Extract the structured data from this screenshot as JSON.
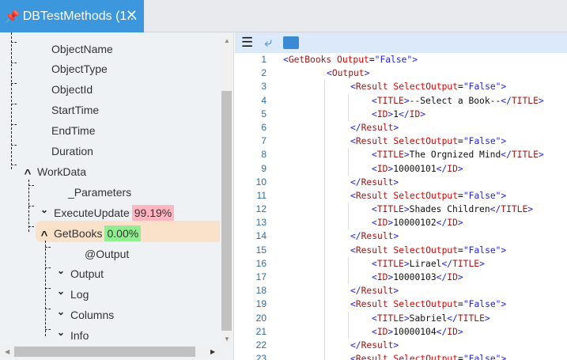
{
  "tab": {
    "title": "DBTestMethods (1...",
    "pin_icon": "pin-icon",
    "close_icon": "close-icon"
  },
  "tree": [
    {
      "label": "ObjectName",
      "depth": 1,
      "chev": ""
    },
    {
      "label": "ObjectType",
      "depth": 1,
      "chev": ""
    },
    {
      "label": "ObjectId",
      "depth": 1,
      "chev": ""
    },
    {
      "label": "StartTime",
      "depth": 1,
      "chev": ""
    },
    {
      "label": "EndTime",
      "depth": 1,
      "chev": ""
    },
    {
      "label": "Duration",
      "depth": 1,
      "chev": ""
    },
    {
      "label": "WorkData",
      "depth": 1,
      "chev": "up"
    },
    {
      "label": "_Parameters",
      "depth": 2,
      "chev": ""
    },
    {
      "label": "ExecuteUpdate",
      "depth": 2,
      "chev": "down",
      "badge": "99.19%",
      "badge_color": "#ffb6c1"
    },
    {
      "label": "GetBooks",
      "depth": 2,
      "chev": "up",
      "badge": "0.00%",
      "badge_color": "#90ee90",
      "selected": true
    },
    {
      "label": "@Output",
      "depth": 3,
      "chev": ""
    },
    {
      "label": "Output",
      "depth": 3,
      "chev": "down"
    },
    {
      "label": "Log",
      "depth": 3,
      "chev": "down"
    },
    {
      "label": "Columns",
      "depth": 3,
      "chev": "down"
    },
    {
      "label": "Info",
      "depth": 3,
      "chev": "down"
    }
  ],
  "toolbar": {
    "icons": [
      "align-left-icon",
      "word-wrap-icon",
      "panel-icon"
    ]
  },
  "code": [
    {
      "n": "1",
      "i": 0,
      "s": [
        [
          "b",
          "<"
        ],
        [
          "t",
          "GetBooks "
        ],
        [
          "a",
          "Output"
        ],
        [
          "x",
          "="
        ],
        [
          "v",
          "\"False\""
        ],
        [
          "b",
          ">"
        ]
      ]
    },
    {
      "n": "2",
      "i": 1,
      "s": [
        [
          "b",
          "<"
        ],
        [
          "t",
          "Output"
        ],
        [
          "b",
          ">"
        ]
      ]
    },
    {
      "n": "3",
      "i": 2,
      "s": [
        [
          "b",
          "<"
        ],
        [
          "t",
          "Result "
        ],
        [
          "a",
          "SelectOutput"
        ],
        [
          "x",
          "="
        ],
        [
          "v",
          "\"False\""
        ],
        [
          "b",
          ">"
        ]
      ]
    },
    {
      "n": "4",
      "i": 3,
      "s": [
        [
          "b",
          "<"
        ],
        [
          "t",
          "TITLE"
        ],
        [
          "b",
          ">"
        ],
        [
          "x",
          "--Select a Book--"
        ],
        [
          "b",
          "</"
        ],
        [
          "t",
          "TITLE"
        ],
        [
          "b",
          ">"
        ]
      ]
    },
    {
      "n": "5",
      "i": 3,
      "s": [
        [
          "b",
          "<"
        ],
        [
          "t",
          "ID"
        ],
        [
          "b",
          ">"
        ],
        [
          "x",
          "1"
        ],
        [
          "b",
          "</"
        ],
        [
          "t",
          "ID"
        ],
        [
          "b",
          ">"
        ]
      ]
    },
    {
      "n": "6",
      "i": 2,
      "s": [
        [
          "b",
          "</"
        ],
        [
          "t",
          "Result"
        ],
        [
          "b",
          ">"
        ]
      ]
    },
    {
      "n": "7",
      "i": 2,
      "s": [
        [
          "b",
          "<"
        ],
        [
          "t",
          "Result "
        ],
        [
          "a",
          "SelectOutput"
        ],
        [
          "x",
          "="
        ],
        [
          "v",
          "\"False\""
        ],
        [
          "b",
          ">"
        ]
      ]
    },
    {
      "n": "8",
      "i": 3,
      "s": [
        [
          "b",
          "<"
        ],
        [
          "t",
          "TITLE"
        ],
        [
          "b",
          ">"
        ],
        [
          "x",
          "The Orgnized Mind"
        ],
        [
          "b",
          "</"
        ],
        [
          "t",
          "TITLE"
        ],
        [
          "b",
          ">"
        ]
      ]
    },
    {
      "n": "9",
      "i": 3,
      "s": [
        [
          "b",
          "<"
        ],
        [
          "t",
          "ID"
        ],
        [
          "b",
          ">"
        ],
        [
          "x",
          "10000101"
        ],
        [
          "b",
          "</"
        ],
        [
          "t",
          "ID"
        ],
        [
          "b",
          ">"
        ]
      ]
    },
    {
      "n": "10",
      "i": 2,
      "s": [
        [
          "b",
          "</"
        ],
        [
          "t",
          "Result"
        ],
        [
          "b",
          ">"
        ]
      ]
    },
    {
      "n": "11",
      "i": 2,
      "s": [
        [
          "b",
          "<"
        ],
        [
          "t",
          "Result "
        ],
        [
          "a",
          "SelectOutput"
        ],
        [
          "x",
          "="
        ],
        [
          "v",
          "\"False\""
        ],
        [
          "b",
          ">"
        ]
      ]
    },
    {
      "n": "12",
      "i": 3,
      "s": [
        [
          "b",
          "<"
        ],
        [
          "t",
          "TITLE"
        ],
        [
          "b",
          ">"
        ],
        [
          "x",
          "Shades Children"
        ],
        [
          "b",
          "</"
        ],
        [
          "t",
          "TITLE"
        ],
        [
          "b",
          ">"
        ]
      ]
    },
    {
      "n": "13",
      "i": 3,
      "s": [
        [
          "b",
          "<"
        ],
        [
          "t",
          "ID"
        ],
        [
          "b",
          ">"
        ],
        [
          "x",
          "10000102"
        ],
        [
          "b",
          "</"
        ],
        [
          "t",
          "ID"
        ],
        [
          "b",
          ">"
        ]
      ]
    },
    {
      "n": "14",
      "i": 2,
      "s": [
        [
          "b",
          "</"
        ],
        [
          "t",
          "Result"
        ],
        [
          "b",
          ">"
        ]
      ]
    },
    {
      "n": "15",
      "i": 2,
      "s": [
        [
          "b",
          "<"
        ],
        [
          "t",
          "Result "
        ],
        [
          "a",
          "SelectOutput"
        ],
        [
          "x",
          "="
        ],
        [
          "v",
          "\"False\""
        ],
        [
          "b",
          ">"
        ]
      ]
    },
    {
      "n": "16",
      "i": 3,
      "s": [
        [
          "b",
          "<"
        ],
        [
          "t",
          "TITLE"
        ],
        [
          "b",
          ">"
        ],
        [
          "x",
          "Lirael"
        ],
        [
          "b",
          "</"
        ],
        [
          "t",
          "TITLE"
        ],
        [
          "b",
          ">"
        ]
      ]
    },
    {
      "n": "17",
      "i": 3,
      "s": [
        [
          "b",
          "<"
        ],
        [
          "t",
          "ID"
        ],
        [
          "b",
          ">"
        ],
        [
          "x",
          "10000103"
        ],
        [
          "b",
          "</"
        ],
        [
          "t",
          "ID"
        ],
        [
          "b",
          ">"
        ]
      ]
    },
    {
      "n": "18",
      "i": 2,
      "s": [
        [
          "b",
          "</"
        ],
        [
          "t",
          "Result"
        ],
        [
          "b",
          ">"
        ]
      ]
    },
    {
      "n": "19",
      "i": 2,
      "s": [
        [
          "b",
          "<"
        ],
        [
          "t",
          "Result "
        ],
        [
          "a",
          "SelectOutput"
        ],
        [
          "x",
          "="
        ],
        [
          "v",
          "\"False\""
        ],
        [
          "b",
          ">"
        ]
      ]
    },
    {
      "n": "20",
      "i": 3,
      "s": [
        [
          "b",
          "<"
        ],
        [
          "t",
          "TITLE"
        ],
        [
          "b",
          ">"
        ],
        [
          "x",
          "Sabriel"
        ],
        [
          "b",
          "</"
        ],
        [
          "t",
          "TITLE"
        ],
        [
          "b",
          ">"
        ]
      ]
    },
    {
      "n": "21",
      "i": 3,
      "s": [
        [
          "b",
          "<"
        ],
        [
          "t",
          "ID"
        ],
        [
          "b",
          ">"
        ],
        [
          "x",
          "10000104"
        ],
        [
          "b",
          "</"
        ],
        [
          "t",
          "ID"
        ],
        [
          "b",
          ">"
        ]
      ]
    },
    {
      "n": "22",
      "i": 2,
      "s": [
        [
          "b",
          "</"
        ],
        [
          "t",
          "Result"
        ],
        [
          "b",
          ">"
        ]
      ]
    },
    {
      "n": "23",
      "i": 2,
      "s": [
        [
          "b",
          "<"
        ],
        [
          "t",
          "Result "
        ],
        [
          "a",
          "SelectOutput"
        ],
        [
          "x",
          "="
        ],
        [
          "v",
          "\"False\""
        ],
        [
          "b",
          ">"
        ]
      ]
    }
  ]
}
